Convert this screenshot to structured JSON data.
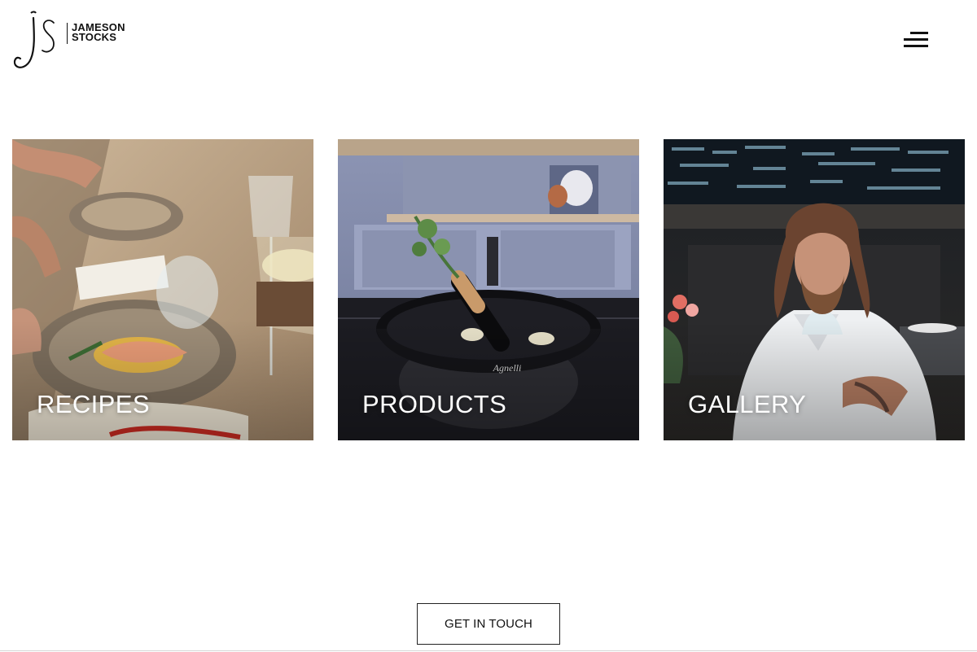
{
  "header": {
    "logo": {
      "monogram": "JS",
      "line1": "JAMESON",
      "line2": "STOCKS"
    },
    "menu_icon": "hamburger-menu-icon"
  },
  "cards": [
    {
      "label": "RECIPES",
      "image": "plated-dishes-at-dining-table"
    },
    {
      "label": "PRODUCTS",
      "image": "black-pan-on-stove-in-kitchen"
    },
    {
      "label": "GALLERY",
      "image": "chef-portrait-in-restaurant"
    }
  ],
  "cta": {
    "label": "GET IN TOUCH"
  },
  "colors": {
    "text": "#111111",
    "background": "#ffffff",
    "overlay_text": "#ffffff"
  }
}
